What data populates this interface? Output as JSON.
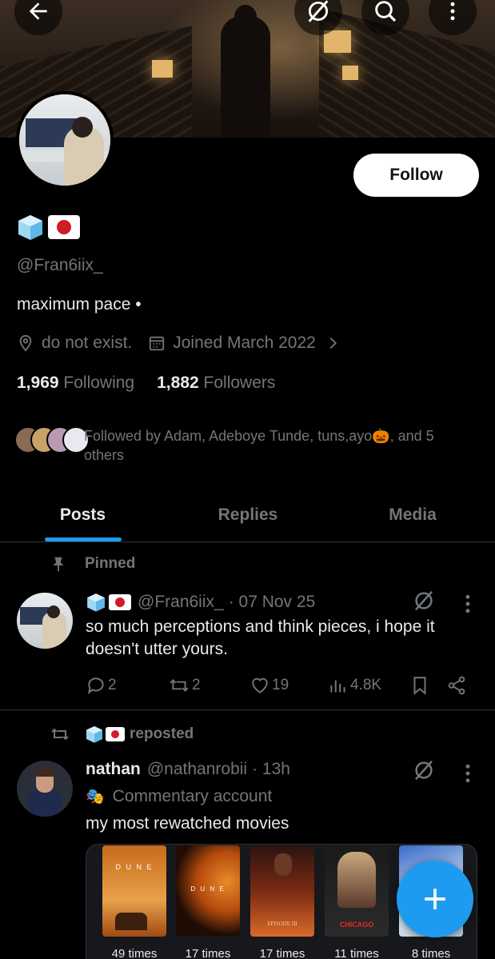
{
  "header": {
    "back_icon": "arrow-left-icon",
    "grok_icon": "grok-icon",
    "search_icon": "search-icon",
    "more_icon": "more-vertical-icon"
  },
  "profile": {
    "display_emojis": [
      "ice-cube",
      "japan-flag"
    ],
    "follow_label": "Follow",
    "handle": "@Fran6iix_",
    "bio": "maximum pace •",
    "location": "do not exist.",
    "joined": "Joined March 2022",
    "following_count": "1,969",
    "following_label": "Following",
    "followers_count": "1,882",
    "followers_label": "Followers",
    "followed_by": "Followed by Adam, Adeboye Tunde, tuns,ayo🎃, and 5 others"
  },
  "tabs": [
    {
      "label": "Posts",
      "active": true
    },
    {
      "label": "Replies",
      "active": false
    },
    {
      "label": "Media",
      "active": false
    }
  ],
  "pinned_post": {
    "pinned_label": "Pinned",
    "handle": "@Fran6iix_",
    "date": "· 07 Nov 25",
    "text": "so much perceptions and think pieces, i hope it doesn't utter yours.",
    "replies": "2",
    "reposts": "2",
    "likes": "19",
    "views": "4.8K"
  },
  "repost": {
    "reposted_label": "reposted",
    "name": "nathan",
    "handle": "@nathanrobii",
    "time": "· 13h",
    "label_emoji": "🎭",
    "label": "Commentary account",
    "text": "my most rewatched movies",
    "movies": [
      {
        "count": "49 times"
      },
      {
        "count": "17 times"
      },
      {
        "count": "17 times"
      },
      {
        "count": "11 times"
      },
      {
        "count": "8 times"
      }
    ],
    "poster_texts": [
      "D U N E",
      "D U N E",
      "EPISODE III",
      "CHICAGO"
    ]
  },
  "colors": {
    "accent": "#1d9bf0",
    "muted": "#71767b",
    "text": "#e7e9ea",
    "background": "#000000"
  }
}
